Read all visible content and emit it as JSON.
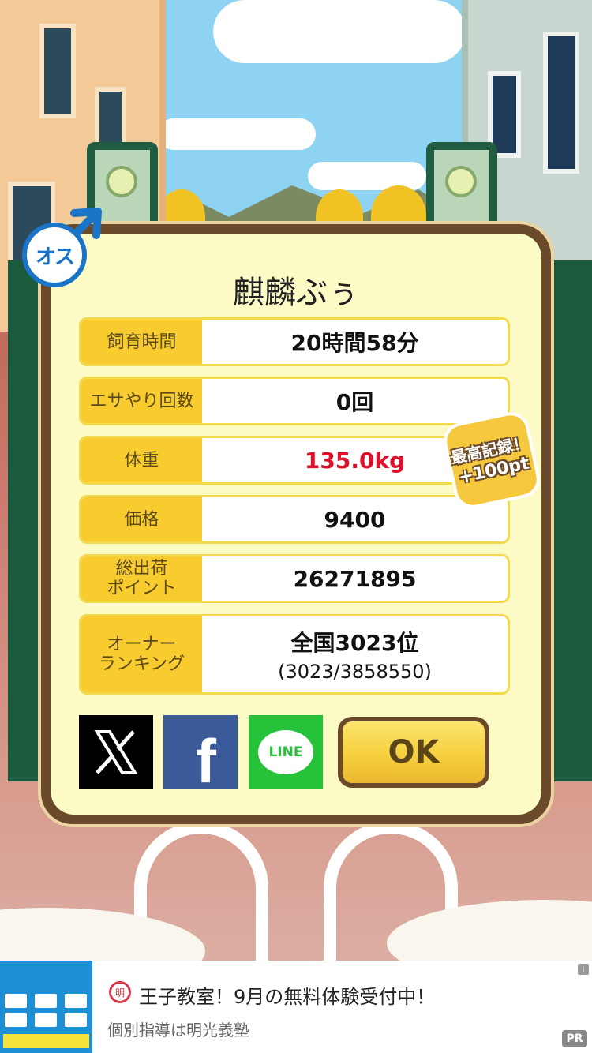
{
  "pet": {
    "name": "麒麟ぶぅ",
    "gender_label": "オス"
  },
  "stats": [
    {
      "label": "飼育時間",
      "value": "20時間58分"
    },
    {
      "label": "エサやり回数",
      "value": "0回"
    },
    {
      "label": "体重",
      "value": "135.0kg"
    },
    {
      "label": "価格",
      "value": "9400"
    },
    {
      "label": "総出荷\nポイント",
      "value": "26271895"
    },
    {
      "label": "オーナー\nランキング",
      "value": "全国3023位",
      "sub": "(3023/3858550)"
    }
  ],
  "record_badge": {
    "line1": "最高記録！",
    "line2": "+100pt"
  },
  "share": {
    "x": "X",
    "facebook": "f",
    "line": "LINE"
  },
  "ok_label": "OK",
  "ad": {
    "logo": "明",
    "title": "王子教室！9月の無料体験受付中！",
    "subtitle": "個別指導は明光義塾",
    "info_icon": "i",
    "pr_label": "PR"
  },
  "colors": {
    "accent_yellow": "#f8cc2e",
    "panel_bg": "#fdfbc5",
    "frame_brown": "#6b4a2c",
    "weight_red": "#e0102a",
    "male_blue": "#1a74c8"
  }
}
